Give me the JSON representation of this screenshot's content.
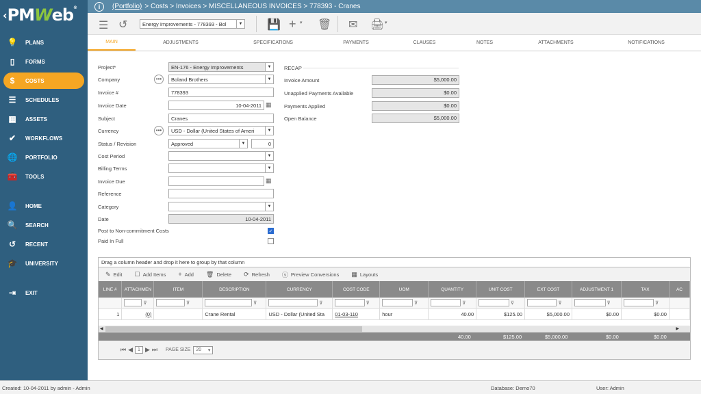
{
  "logo": {
    "pm": "PM",
    "w": "W",
    "eb": "eb",
    "reg": "®"
  },
  "nav": [
    {
      "label": "PLANS",
      "icon": "💡"
    },
    {
      "label": "FORMS",
      "icon": "▯"
    },
    {
      "label": "COSTS",
      "icon": "$"
    },
    {
      "label": "SCHEDULES",
      "icon": "☰"
    },
    {
      "label": "ASSETS",
      "icon": "▦"
    },
    {
      "label": "WORKFLOWS",
      "icon": "✔"
    },
    {
      "label": "PORTFOLIO",
      "icon": "🌐"
    },
    {
      "label": "TOOLS",
      "icon": "🧰"
    },
    {
      "label": "HOME",
      "icon": "👤"
    },
    {
      "label": "SEARCH",
      "icon": "🔍"
    },
    {
      "label": "RECENT",
      "icon": "↺"
    },
    {
      "label": "UNIVERSITY",
      "icon": "🎓"
    },
    {
      "label": "EXIT",
      "icon": "⇥"
    }
  ],
  "breadcrumb": {
    "portfolio": "(Portfolio)",
    "rest": "> Costs > Invoices > MISCELLANEOUS INVOICES > 778393 - Cranes"
  },
  "toolbar": {
    "record_select": "Energy Improvements - 778393 - Bol"
  },
  "tabs": [
    "MAIN",
    "ADJUSTMENTS",
    "SPECIFICATIONS",
    "PAYMENTS",
    "CLAUSES",
    "NOTES",
    "ATTACHMENTS",
    "NOTIFICATIONS"
  ],
  "form": {
    "project_label": "Project*",
    "project": "EN-176 - Energy Improvements",
    "company_label": "Company",
    "company": "Boland Brothers",
    "invoice_no_label": "Invoice #",
    "invoice_no": "778393",
    "invoice_date_label": "Invoice Date",
    "invoice_date": "10-04-2011",
    "subject_label": "Subject",
    "subject": "Cranes",
    "currency_label": "Currency",
    "currency": "USD - Dollar (United States of Ameri",
    "status_label": "Status / Revision",
    "status": "Approved",
    "revision": "0",
    "cost_period_label": "Cost Period",
    "cost_period": "",
    "billing_terms_label": "Billing Terms",
    "billing_terms": "",
    "invoice_due_label": "Invoice Due",
    "invoice_due": "",
    "reference_label": "Reference",
    "reference": "",
    "category_label": "Category",
    "category": "",
    "date_label": "Date",
    "date": "10-04-2011",
    "post_label": "Post to Non-commitment Costs",
    "post_checked": true,
    "paid_label": "Paid In Full",
    "paid_checked": false
  },
  "recap": {
    "title": "RECAP",
    "invoice_amount_label": "Invoice Amount",
    "invoice_amount": "$5,000.00",
    "unapplied_label": "Unapplied Payments Available",
    "unapplied": "$0.00",
    "applied_label": "Payments Applied",
    "applied": "$0.00",
    "open_label": "Open Balance",
    "open": "$5,000.00"
  },
  "grid": {
    "group_hint": "Drag a column header and drop it here to group by that column",
    "buttons": {
      "edit": "Edit",
      "add_items": "Add Items",
      "add": "Add",
      "delete": "Delete",
      "refresh": "Refresh",
      "preview": "Preview Conversions",
      "layouts": "Layouts"
    },
    "columns": [
      "LINE #",
      "ATTACHMEN",
      "ITEM",
      "DESCRIPTION",
      "CURRENCY",
      "COST CODE",
      "UOM",
      "QUANTITY",
      "UNIT COST",
      "EXT COST",
      "ADJUSTMENT 1",
      "TAX",
      "AC"
    ],
    "row": {
      "line": "1",
      "attach": "(0)",
      "item": "",
      "description": "Crane Rental",
      "currency": "USD - Dollar (United Sta",
      "cost_code": "01-03-110",
      "uom": "hour",
      "quantity": "40.00",
      "unit_cost": "$125.00",
      "ext_cost": "$5,000.00",
      "adjustment": "$0.00",
      "tax": "$0.00"
    },
    "totals": {
      "quantity": "40.00",
      "unit_cost": "$125.00",
      "ext_cost": "$5,000.00",
      "adjustment": "$0.00",
      "tax": "$0.00"
    },
    "pager": {
      "page": "1",
      "page_size_label": "PAGE SIZE",
      "page_size": "20"
    }
  },
  "status": {
    "created": "Created:  10-04-2011 by admin - Admin",
    "database": "Database:    Demo70",
    "user": "User:  Admin"
  }
}
